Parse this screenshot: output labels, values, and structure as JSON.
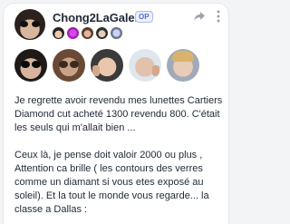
{
  "post": {
    "username": "Chong2LaGalere",
    "op_badge": "OP",
    "body": "Je regrette avoir revendu mes lunettes Cartiers Diamond cut acheté 1300 revendu 800. C'était les seuls qui m'allait bien ...\n\nCeux là, je pense doit valoir 2000 ou plus , Attention ca brille ( les contours des verres comme un diamant si vous etes exposé au soleil). Et la tout le monde vous regarde... la classe a Dallas :"
  },
  "icons": {
    "share": "share-arrow-icon",
    "menu": "more-vertical-icon"
  },
  "colors": {
    "op_badge_text": "#4f6fd8",
    "text": "#1f2937",
    "icon": "#9ca3af"
  }
}
